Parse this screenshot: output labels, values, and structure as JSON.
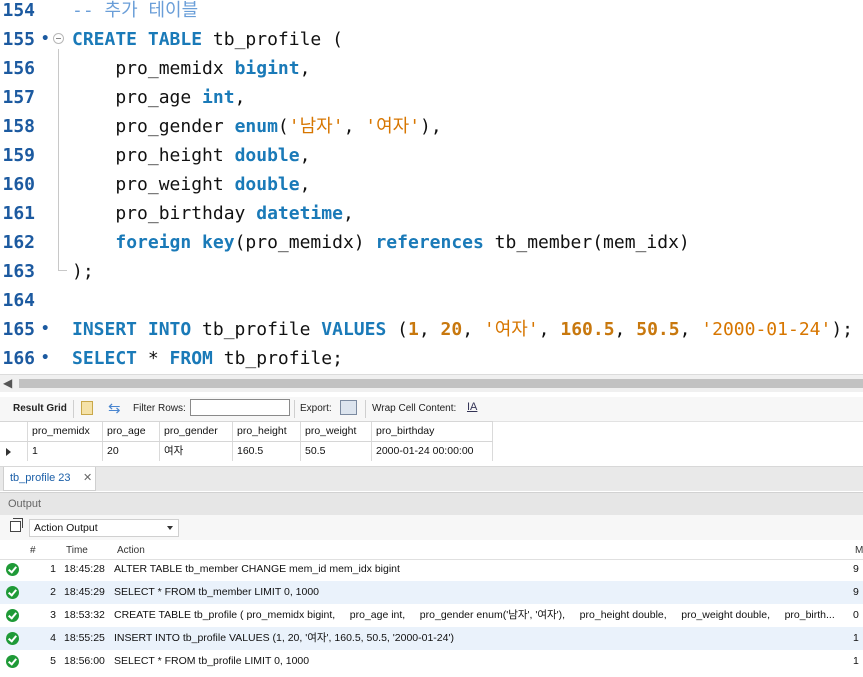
{
  "editor": {
    "lines": [
      {
        "num": "154",
        "marker": "",
        "tokens": [
          {
            "t": "-- 추가 테이블",
            "c": "cmt"
          }
        ]
      },
      {
        "num": "155",
        "marker": "•",
        "fold": true,
        "tokens": [
          {
            "t": "CREATE TABLE ",
            "c": "kw"
          },
          {
            "t": "tb_profile (",
            "c": "id"
          }
        ]
      },
      {
        "num": "156",
        "marker": "",
        "tokens": [
          {
            "t": "    pro_memidx ",
            "c": "id"
          },
          {
            "t": "bigint",
            "c": "kw"
          },
          {
            "t": ",",
            "c": "id"
          }
        ]
      },
      {
        "num": "157",
        "marker": "",
        "tokens": [
          {
            "t": "    pro_age ",
            "c": "id"
          },
          {
            "t": "int",
            "c": "kw"
          },
          {
            "t": ",",
            "c": "id"
          }
        ]
      },
      {
        "num": "158",
        "marker": "",
        "tokens": [
          {
            "t": "    pro_gender ",
            "c": "id"
          },
          {
            "t": "enum",
            "c": "kw"
          },
          {
            "t": "(",
            "c": "id"
          },
          {
            "t": "'남자'",
            "c": "str"
          },
          {
            "t": ", ",
            "c": "id"
          },
          {
            "t": "'여자'",
            "c": "str"
          },
          {
            "t": "),",
            "c": "id"
          }
        ]
      },
      {
        "num": "159",
        "marker": "",
        "tokens": [
          {
            "t": "    pro_height ",
            "c": "id"
          },
          {
            "t": "double",
            "c": "kw"
          },
          {
            "t": ",",
            "c": "id"
          }
        ]
      },
      {
        "num": "160",
        "marker": "",
        "tokens": [
          {
            "t": "    pro_weight ",
            "c": "id"
          },
          {
            "t": "double",
            "c": "kw"
          },
          {
            "t": ",",
            "c": "id"
          }
        ]
      },
      {
        "num": "161",
        "marker": "",
        "tokens": [
          {
            "t": "    pro_birthday ",
            "c": "id"
          },
          {
            "t": "datetime",
            "c": "kw"
          },
          {
            "t": ",",
            "c": "id"
          }
        ]
      },
      {
        "num": "162",
        "marker": "",
        "tokens": [
          {
            "t": "    ",
            "c": "id"
          },
          {
            "t": "foreign key",
            "c": "kw"
          },
          {
            "t": "(pro_memidx) ",
            "c": "id"
          },
          {
            "t": "references",
            "c": "kw"
          },
          {
            "t": " tb_member(mem_idx)",
            "c": "id"
          }
        ]
      },
      {
        "num": "163",
        "marker": "",
        "tokens": [
          {
            "t": ");",
            "c": "id"
          }
        ]
      },
      {
        "num": "164",
        "marker": "",
        "tokens": []
      },
      {
        "num": "165",
        "marker": "•",
        "tokens": [
          {
            "t": "INSERT INTO ",
            "c": "kw"
          },
          {
            "t": "tb_profile ",
            "c": "id"
          },
          {
            "t": "VALUES ",
            "c": "kw"
          },
          {
            "t": "(",
            "c": "id"
          },
          {
            "t": "1",
            "c": "num"
          },
          {
            "t": ", ",
            "c": "id"
          },
          {
            "t": "20",
            "c": "num"
          },
          {
            "t": ", ",
            "c": "id"
          },
          {
            "t": "'여자'",
            "c": "str"
          },
          {
            "t": ", ",
            "c": "id"
          },
          {
            "t": "160.5",
            "c": "num"
          },
          {
            "t": ", ",
            "c": "id"
          },
          {
            "t": "50.5",
            "c": "num"
          },
          {
            "t": ", ",
            "c": "id"
          },
          {
            "t": "'2000-01-24'",
            "c": "str"
          },
          {
            "t": ");",
            "c": "id"
          }
        ]
      },
      {
        "num": "166",
        "marker": "•",
        "tokens": [
          {
            "t": "SELECT ",
            "c": "kw"
          },
          {
            "t": "* ",
            "c": "id"
          },
          {
            "t": "FROM ",
            "c": "kw"
          },
          {
            "t": "tb_profile;",
            "c": "id"
          }
        ]
      }
    ]
  },
  "result_toolbar": {
    "result_grid": "Result Grid",
    "filter_rows": "Filter Rows:",
    "filter_value": "",
    "export": "Export:",
    "wrap_cell": "Wrap Cell Content:",
    "wrap_icon": "wrap-icon"
  },
  "result_grid": {
    "columns": [
      "pro_memidx",
      "pro_age",
      "pro_gender",
      "pro_height",
      "pro_weight",
      "pro_birthday"
    ],
    "rows": [
      [
        "1",
        "20",
        "여자",
        "160.5",
        "50.5",
        "2000-01-24 00:00:00"
      ]
    ]
  },
  "result_tab": {
    "label": "tb_profile 23",
    "close": "✕"
  },
  "output": {
    "header": "Output",
    "mode": "Action Output",
    "columns": {
      "num": "#",
      "time": "Time",
      "action": "Action",
      "message": "M"
    },
    "rows": [
      {
        "num": "1",
        "time": "18:45:28",
        "action": "ALTER TABLE tb_member CHANGE mem_id mem_idx bigint",
        "message": "9"
      },
      {
        "num": "2",
        "time": "18:45:29",
        "action": "SELECT * FROM tb_member LIMIT 0, 1000",
        "message": "9"
      },
      {
        "num": "3",
        "time": "18:53:32",
        "action": "CREATE TABLE tb_profile ( pro_memidx bigint,     pro_age int,     pro_gender enum('남자', '여자'),     pro_height double,     pro_weight double,     pro_birth...",
        "message": "0"
      },
      {
        "num": "4",
        "time": "18:55:25",
        "action": "INSERT INTO tb_profile VALUES (1, 20, '여자', 160.5, 50.5, '2000-01-24')",
        "message": "1"
      },
      {
        "num": "5",
        "time": "18:56:00",
        "action": "SELECT * FROM tb_profile LIMIT 0, 1000",
        "message": "1"
      }
    ]
  },
  "colors": {
    "keyword": "#1a7ab8",
    "line_number": "#1c5aa0",
    "string": "#d77600",
    "number": "#c8780e",
    "success": "#1f9a37"
  }
}
